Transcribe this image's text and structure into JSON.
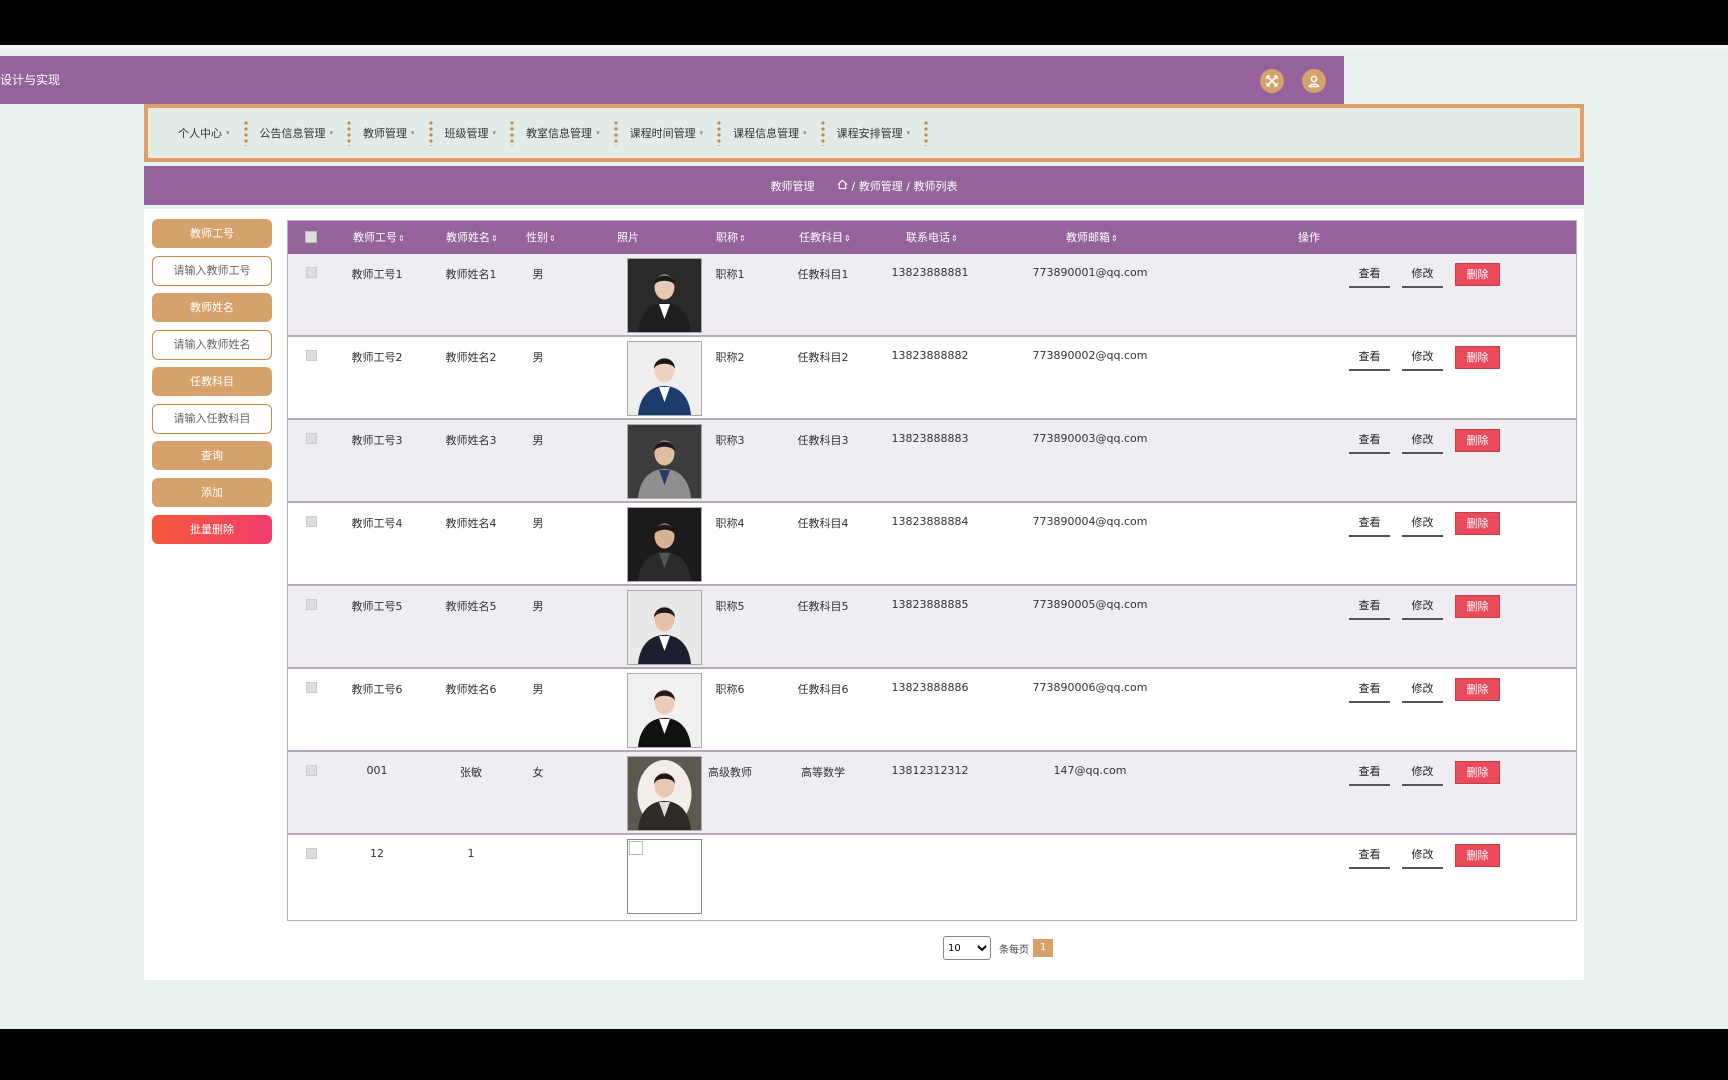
{
  "app": {
    "title": "设计与实现"
  },
  "header": {
    "fullscreen_icon": "expand-icon",
    "user_icon": "user-icon"
  },
  "nav": {
    "items": [
      {
        "label": "个人中心"
      },
      {
        "label": "公告信息管理"
      },
      {
        "label": "教师管理"
      },
      {
        "label": "班级管理"
      },
      {
        "label": "教室信息管理"
      },
      {
        "label": "课程时间管理"
      },
      {
        "label": "课程信息管理"
      },
      {
        "label": "课程安排管理"
      }
    ],
    "caret": "▾"
  },
  "breadcrumb": {
    "title": "教师管理",
    "path": "/ 教师管理 / 教师列表"
  },
  "search": {
    "teacher_no_label": "教师工号",
    "teacher_no_placeholder": "请输入教师工号",
    "teacher_name_label": "教师姓名",
    "teacher_name_placeholder": "请输入教师姓名",
    "subject_label": "任教科目",
    "subject_placeholder": "请输入任教科目",
    "query_button": "查询",
    "add_button": "添加",
    "batch_delete_button": "批量删除"
  },
  "table": {
    "columns": [
      "教师工号",
      "教师姓名",
      "性别",
      "照片",
      "职称",
      "任教科目",
      "联系电话",
      "教师邮箱",
      "操作"
    ],
    "sort_glyph": "⇕",
    "actions": {
      "view": "查看",
      "edit": "修改",
      "delete": "删除"
    },
    "rows": [
      {
        "no": "教师工号1",
        "name": "教师姓名1",
        "gender": "男",
        "title": "职称1",
        "subject": "任教科目1",
        "phone": "13823888881",
        "email": "773890001@qq.com"
      },
      {
        "no": "教师工号2",
        "name": "教师姓名2",
        "gender": "男",
        "title": "职称2",
        "subject": "任教科目2",
        "phone": "13823888882",
        "email": "773890002@qq.com"
      },
      {
        "no": "教师工号3",
        "name": "教师姓名3",
        "gender": "男",
        "title": "职称3",
        "subject": "任教科目3",
        "phone": "13823888883",
        "email": "773890003@qq.com"
      },
      {
        "no": "教师工号4",
        "name": "教师姓名4",
        "gender": "男",
        "title": "职称4",
        "subject": "任教科目4",
        "phone": "13823888884",
        "email": "773890004@qq.com"
      },
      {
        "no": "教师工号5",
        "name": "教师姓名5",
        "gender": "男",
        "title": "职称5",
        "subject": "任教科目5",
        "phone": "13823888885",
        "email": "773890005@qq.com"
      },
      {
        "no": "教师工号6",
        "name": "教师姓名6",
        "gender": "男",
        "title": "职称6",
        "subject": "任教科目6",
        "phone": "13823888886",
        "email": "773890006@qq.com"
      },
      {
        "no": "001",
        "name": "张敏",
        "gender": "女",
        "title": "高级教师",
        "subject": "高等数学",
        "phone": "13812312312",
        "email": "147@qq.com"
      },
      {
        "no": "12",
        "name": "1",
        "gender": "",
        "title": "",
        "subject": "",
        "phone": "",
        "email": ""
      }
    ]
  },
  "pagination": {
    "page_size": "10",
    "per_page_label": "条每页",
    "current_page": "1"
  },
  "colors": {
    "purple": "#94639c",
    "tan": "#d6a26b",
    "danger": "#ea4a5a",
    "background": "#e8f1ee"
  }
}
